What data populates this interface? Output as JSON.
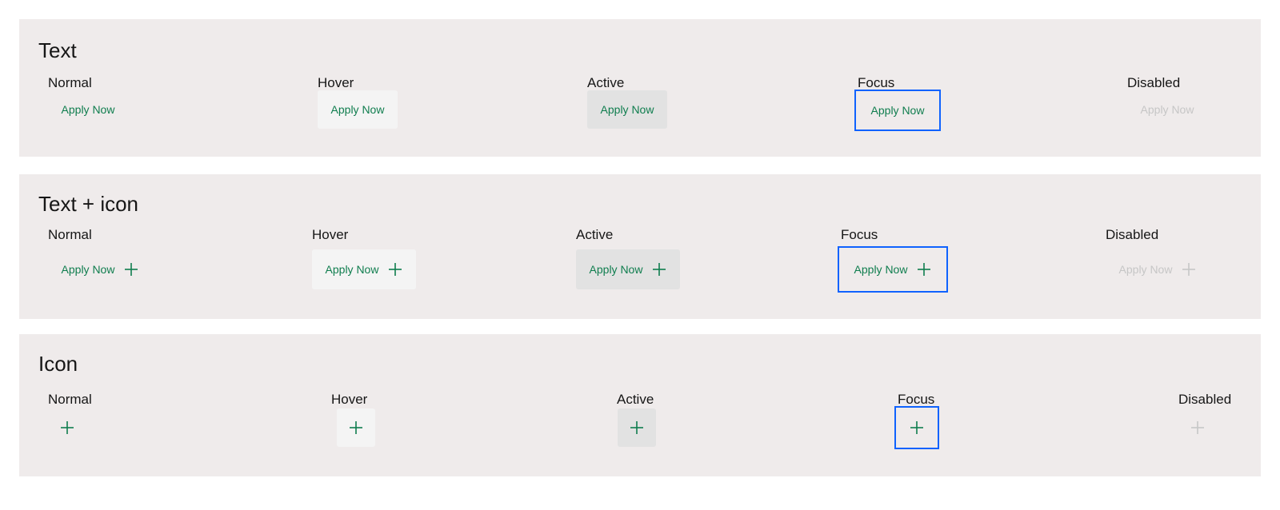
{
  "sections": [
    {
      "title": "Text",
      "states": [
        {
          "label": "Normal",
          "button": "Apply Now"
        },
        {
          "label": "Hover",
          "button": "Apply Now"
        },
        {
          "label": "Active",
          "button": "Apply Now"
        },
        {
          "label": "Focus",
          "button": "Apply Now"
        },
        {
          "label": "Disabled",
          "button": "Apply Now"
        }
      ]
    },
    {
      "title": "Text + icon",
      "states": [
        {
          "label": "Normal",
          "button": "Apply Now",
          "icon": "plus-icon"
        },
        {
          "label": "Hover",
          "button": "Apply Now",
          "icon": "plus-icon"
        },
        {
          "label": "Active",
          "button": "Apply Now",
          "icon": "plus-icon"
        },
        {
          "label": "Focus",
          "button": "Apply Now",
          "icon": "plus-icon"
        },
        {
          "label": "Disabled",
          "button": "Apply Now",
          "icon": "plus-icon"
        }
      ]
    },
    {
      "title": "Icon",
      "states": [
        {
          "label": "Normal",
          "icon": "plus-icon"
        },
        {
          "label": "Hover",
          "icon": "plus-icon"
        },
        {
          "label": "Active",
          "icon": "plus-icon"
        },
        {
          "label": "Focus",
          "icon": "plus-icon"
        },
        {
          "label": "Disabled",
          "icon": "plus-icon"
        }
      ]
    }
  ],
  "colors": {
    "section_bg": "#efebeb",
    "accent_green": "#0f7d4e",
    "hover_bg": "#f4f4f4",
    "active_bg": "#e2e2e2",
    "focus_border": "#0f62fe",
    "disabled_text": "#c6c6c6",
    "heading_text": "#161616"
  }
}
